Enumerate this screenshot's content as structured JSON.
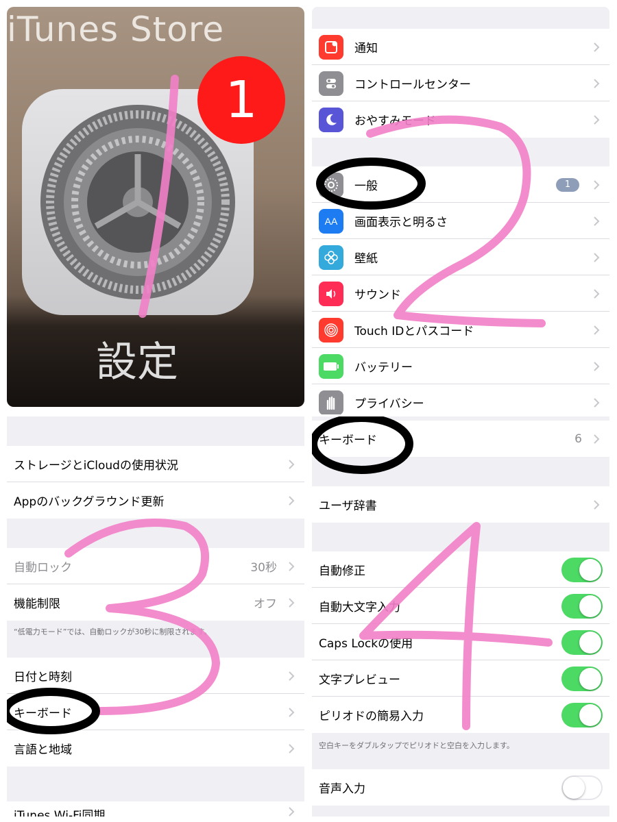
{
  "home": {
    "store_label": "iTunes Store",
    "badge": "1",
    "app_name": "設定"
  },
  "settings_main": {
    "items": [
      {
        "label": "通知",
        "icon": "notifications-icon",
        "color": "#ff3b30"
      },
      {
        "label": "コントロールセンター",
        "icon": "control-center-icon",
        "color": "#8e8e93"
      },
      {
        "label": "おやすみモード",
        "icon": "moon-icon",
        "color": "#5856d6"
      },
      {
        "label": "一般",
        "icon": "gear-icon",
        "color": "#8e8e93",
        "badge": "1"
      },
      {
        "label": "画面表示と明るさ",
        "icon": "display-aa-icon",
        "color": "#1e7cf2"
      },
      {
        "label": "壁紙",
        "icon": "wallpaper-flower-icon",
        "color": "#34aadc"
      },
      {
        "label": "サウンド",
        "icon": "speaker-icon",
        "color": "#ff2d55"
      },
      {
        "label": "Touch IDとパスコード",
        "icon": "fingerprint-icon",
        "color": "#ff3b30"
      },
      {
        "label": "バッテリー",
        "icon": "battery-icon",
        "color": "#4cd964"
      },
      {
        "label": "プライバシー",
        "icon": "hand-icon",
        "color": "#8e8e93"
      }
    ]
  },
  "general": {
    "storage": "ストレージとiCloudの使用状況",
    "bg_refresh": "Appのバックグラウンド更新",
    "auto_lock": {
      "label": "自動ロック",
      "value": "30秒"
    },
    "restrictions": {
      "label": "機能制限",
      "value": "オフ"
    },
    "note": "“低電力モード”では、自動ロックが30秒に制限されます。",
    "datetime": "日付と時刻",
    "keyboard": "キーボード",
    "language": "言語と地域",
    "itunes_wifi": "iTunes Wi-Fi同期"
  },
  "keyboard": {
    "keyboards": {
      "label": "キーボード",
      "value": "6"
    },
    "user_dict": "ユーザ辞書",
    "toggles": [
      {
        "label": "自動修正",
        "on": true
      },
      {
        "label": "自動大文字入力",
        "on": true
      },
      {
        "label": "Caps Lockの使用",
        "on": true
      },
      {
        "label": "文字プレビュー",
        "on": true
      },
      {
        "label": "ピリオドの簡易入力",
        "on": true
      }
    ],
    "note": "空白キーをダブルタップでピリオドと空白を入力します。",
    "dictation": {
      "label": "音声入力",
      "on": false
    }
  },
  "annotations": {
    "step1": "1",
    "step2": "2",
    "step3": "3",
    "step4": "4",
    "ink_color": "#f27fc8",
    "circle_color": "#000000"
  }
}
